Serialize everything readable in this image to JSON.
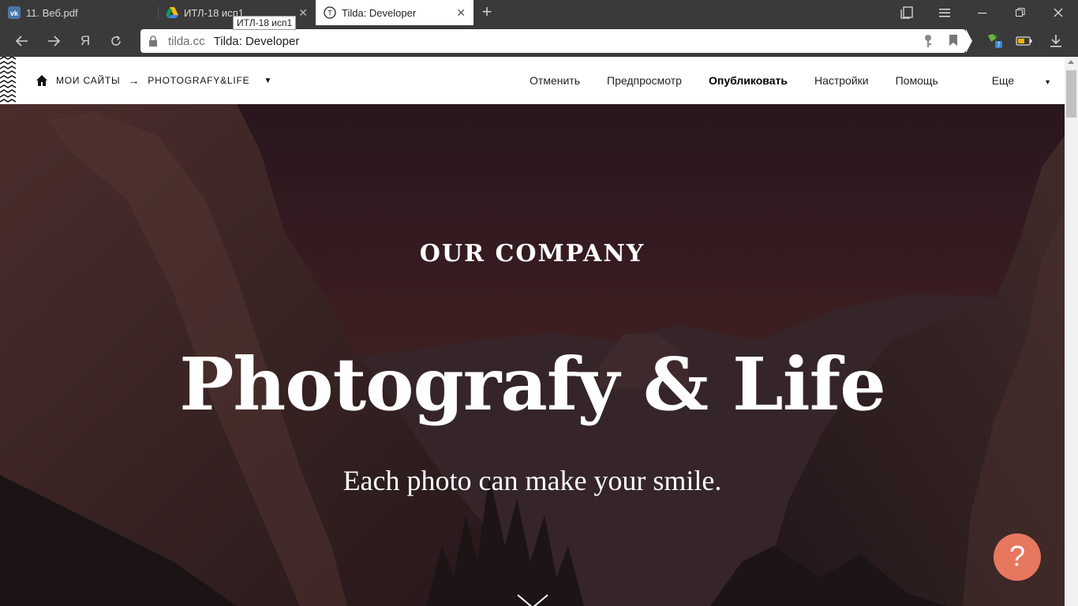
{
  "browser": {
    "tabs": [
      {
        "title": "11. Веб.pdf",
        "icon": "vk-icon",
        "active": false
      },
      {
        "title": "ИТЛ-18 исп1",
        "icon": "google-drive-icon",
        "active": false
      },
      {
        "title": "Tilda: Developer",
        "icon": "tilda-icon",
        "active": true
      }
    ],
    "tooltip": "ИТЛ-18 исп1",
    "address": {
      "domain": "tilda.cc",
      "title": "Tilda: Developer"
    }
  },
  "editor": {
    "breadcrumb": {
      "root": "МОИ САЙТЫ",
      "arrow": "→",
      "site": "PHOTOGRAFY&LIFE"
    },
    "menu": {
      "cancel": "Отменить",
      "preview": "Предпросмотр",
      "publish": "Опубликовать",
      "settings": "Настройки",
      "help": "Помощь",
      "more": "Еще"
    }
  },
  "hero": {
    "kicker": "OUR COMPANY",
    "headline": "Photografy & Life",
    "subtitle": "Each photo can make your smile.",
    "help_button": "?"
  },
  "colors": {
    "accent": "#e7775f",
    "hero_overlay": "#2e1f22",
    "chrome": "#3a3a3a"
  }
}
